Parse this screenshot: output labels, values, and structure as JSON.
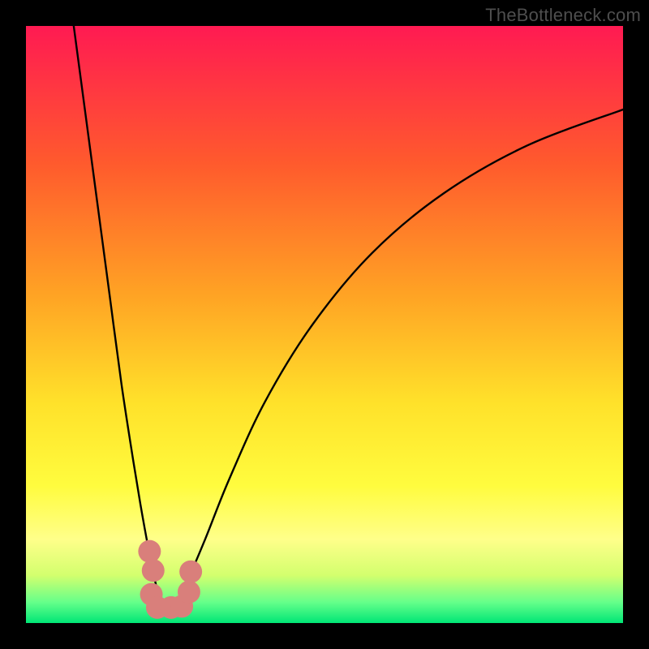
{
  "watermark": "TheBottleneck.com",
  "chart_data": {
    "type": "line",
    "title": "",
    "xlabel": "",
    "ylabel": "",
    "xlim": [
      0,
      100
    ],
    "ylim": [
      0,
      100
    ],
    "legend": false,
    "grid": false,
    "background_gradient_stops": [
      {
        "pct": 0.0,
        "color": "#ff1a52"
      },
      {
        "pct": 0.23,
        "color": "#ff5a2d"
      },
      {
        "pct": 0.45,
        "color": "#ffa324"
      },
      {
        "pct": 0.63,
        "color": "#ffe12a"
      },
      {
        "pct": 0.77,
        "color": "#fffc3e"
      },
      {
        "pct": 0.86,
        "color": "#ffff8a"
      },
      {
        "pct": 0.92,
        "color": "#d3ff6e"
      },
      {
        "pct": 0.965,
        "color": "#66ff8a"
      },
      {
        "pct": 1.0,
        "color": "#00e676"
      }
    ],
    "minimum_x": 23,
    "series": [
      {
        "name": "left-arm",
        "x": [
          8.0,
          10.0,
          12.0,
          14.0,
          16.0,
          18.0,
          19.5,
          21.0,
          22.0,
          23.0,
          24.0
        ],
        "y": [
          100.0,
          85.0,
          70.0,
          55.0,
          40.0,
          27.0,
          18.0,
          10.0,
          5.5,
          2.5,
          2.0
        ]
      },
      {
        "name": "right-arm",
        "x": [
          24.0,
          25.0,
          27.0,
          30.0,
          34.0,
          40.0,
          48.0,
          58.0,
          70.0,
          84.0,
          100.0
        ],
        "y": [
          2.0,
          3.0,
          7.0,
          14.0,
          24.0,
          37.0,
          50.0,
          62.0,
          72.0,
          80.0,
          86.0
        ]
      }
    ],
    "markers": {
      "name": "bottom-cluster",
      "color": "#d97f7b",
      "points": [
        {
          "x": 20.7,
          "y": 12.0
        },
        {
          "x": 21.3,
          "y": 8.8
        },
        {
          "x": 21.0,
          "y": 4.8
        },
        {
          "x": 22.0,
          "y": 2.6
        },
        {
          "x": 24.3,
          "y": 2.6
        },
        {
          "x": 26.1,
          "y": 2.8
        },
        {
          "x": 27.3,
          "y": 5.2
        },
        {
          "x": 27.6,
          "y": 8.6
        }
      ]
    }
  }
}
